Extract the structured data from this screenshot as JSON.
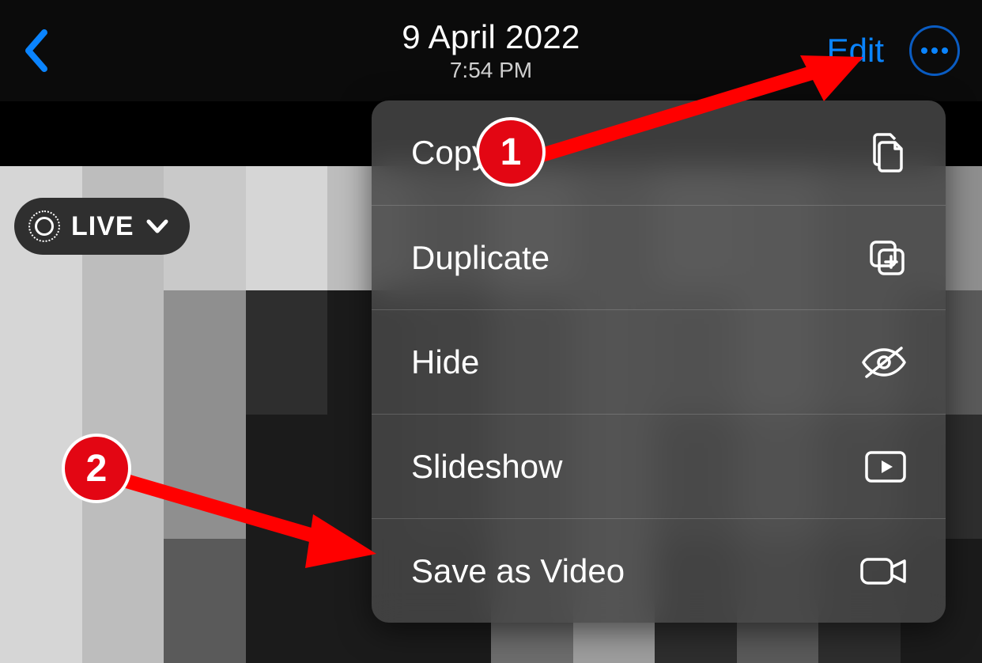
{
  "header": {
    "date": "9 April 2022",
    "time": "7:54 PM",
    "edit_label": "Edit"
  },
  "live_badge": {
    "label": "LIVE"
  },
  "menu": {
    "items": [
      {
        "label": "Copy",
        "icon": "copy-icon"
      },
      {
        "label": "Duplicate",
        "icon": "duplicate-icon"
      },
      {
        "label": "Hide",
        "icon": "hide-icon"
      },
      {
        "label": "Slideshow",
        "icon": "slideshow-icon"
      },
      {
        "label": "Save as Video",
        "icon": "video-icon"
      }
    ]
  },
  "annotations": {
    "step1": "1",
    "step2": "2"
  }
}
